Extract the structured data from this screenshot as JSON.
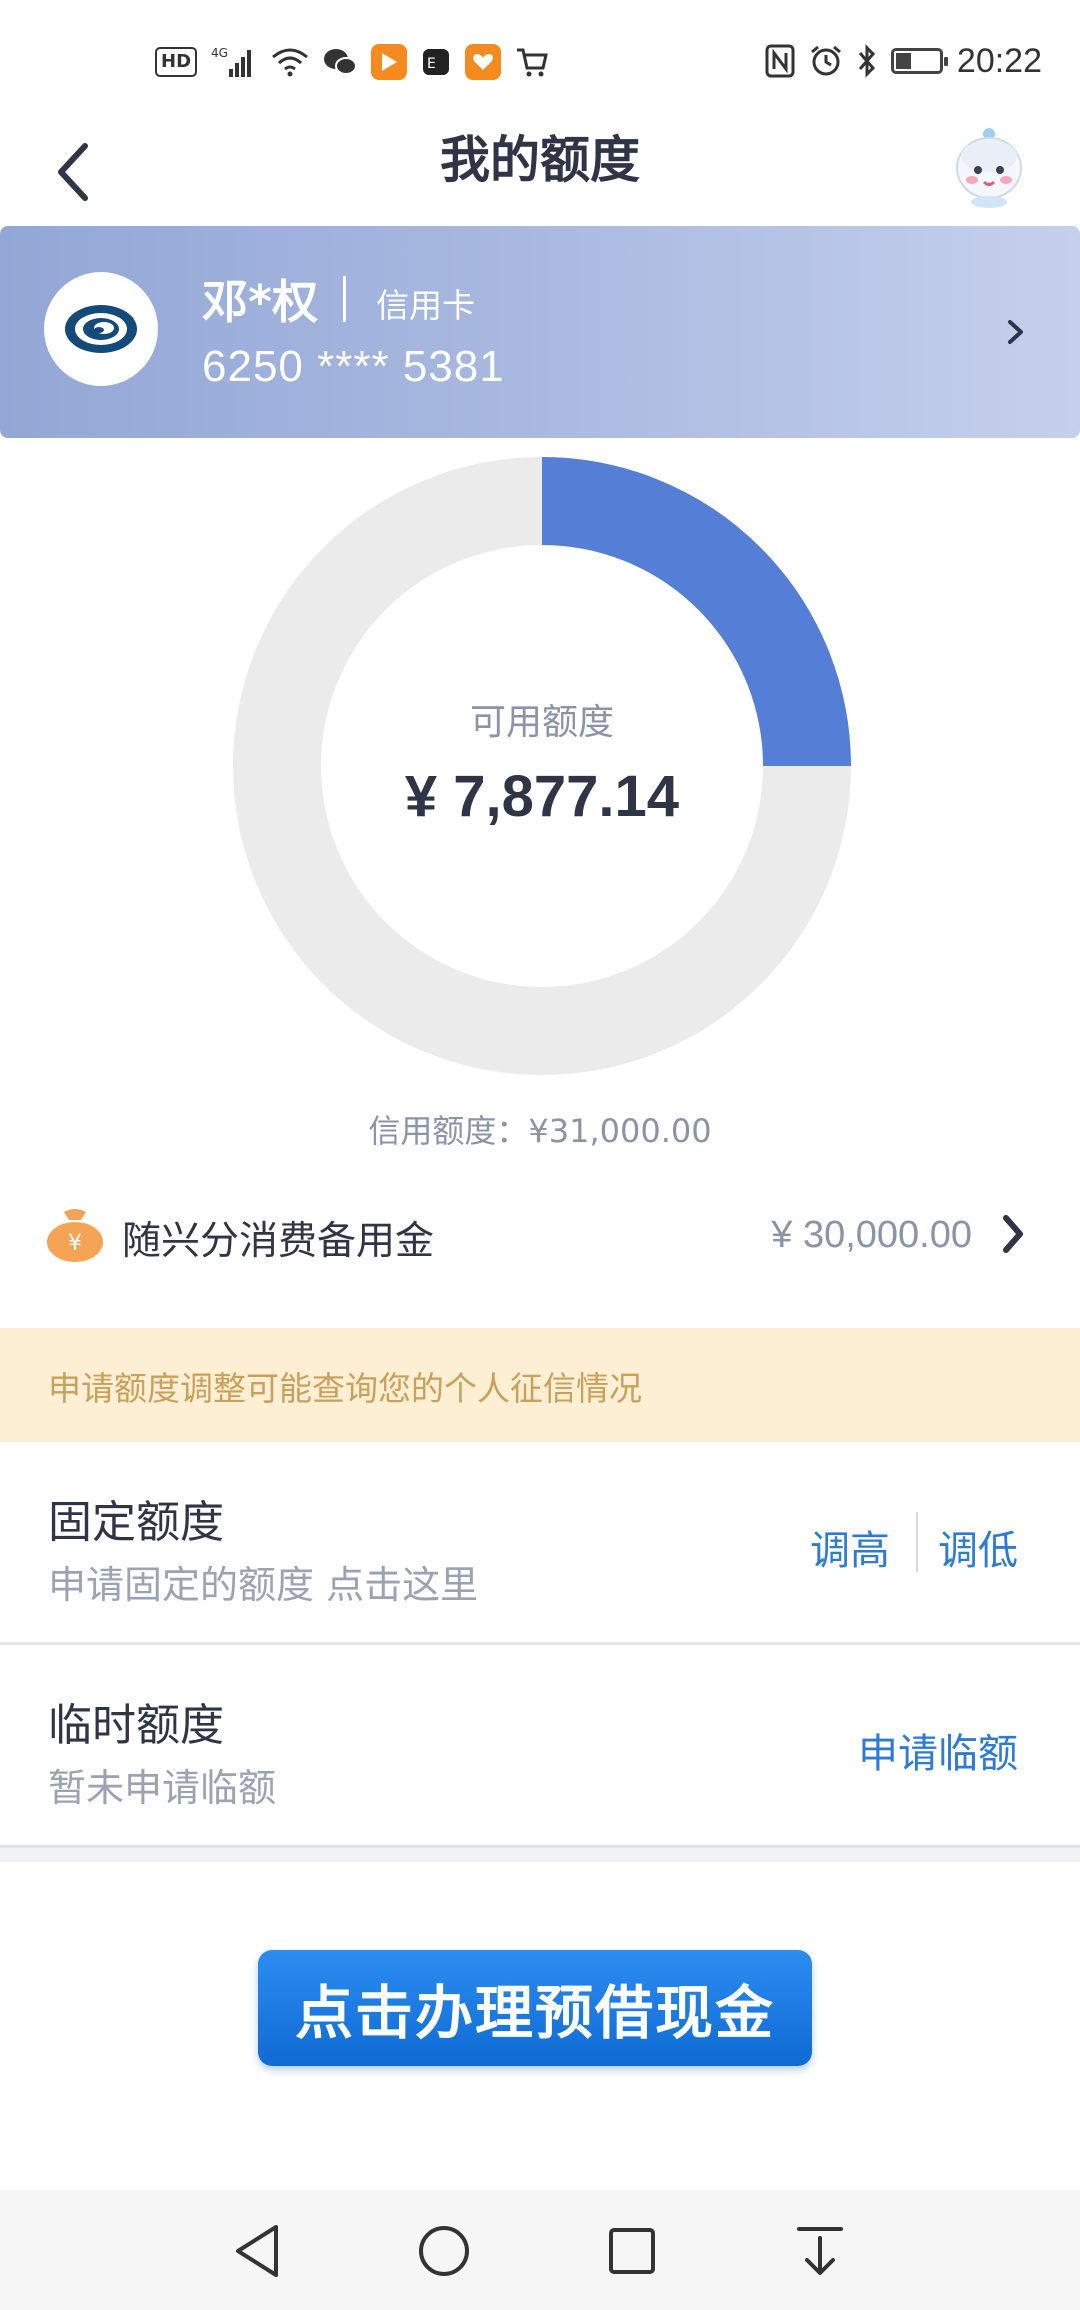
{
  "status_bar": {
    "left_icons": [
      "hd-icon",
      "signal-4g-icon",
      "wifi-icon",
      "wechat-icon",
      "video-app-icon",
      "app-icon",
      "heart-app-icon",
      "cart-icon"
    ],
    "hd_label": "HD",
    "network_label": "4G",
    "right_icons": [
      "nfc-icon",
      "alarm-icon",
      "bluetooth-icon",
      "battery-icon"
    ],
    "battery_level": 0.4,
    "time": "20:22"
  },
  "header": {
    "title": "我的额度",
    "back_icon": "chevron-left-icon",
    "assistant_icon": "mascot-icon"
  },
  "card": {
    "holder": "邓*权",
    "type": "信用卡",
    "number": "6250 **** 5381",
    "logo_icon": "bank-logo-icon",
    "chevron_icon": "chevron-right-icon"
  },
  "donut": {
    "used_fraction": 0.25,
    "used_color": "#557ed6",
    "track_color": "#ebebeb",
    "label": "可用额度",
    "value": "¥ 7,877.14"
  },
  "credit_limit": "信用额度：¥31,000.00",
  "reserve": {
    "icon": "money-bag-icon",
    "label": "随兴分消费备用金",
    "value": "¥ 30,000.00"
  },
  "notice": "申请额度调整可能查询您的个人征信情况",
  "fixed_limit": {
    "title": "固定额度",
    "subtitle": "申请固定的额度 点击这里",
    "increase": "调高",
    "decrease": "调低"
  },
  "temp_limit": {
    "title": "临时额度",
    "subtitle": "暂未申请临额",
    "apply": "申请临额"
  },
  "cta": "点击办理预借现金",
  "nav": [
    "back-nav-icon",
    "home-nav-icon",
    "recents-nav-icon",
    "notification-pull-icon"
  ],
  "colors": {
    "accent_blue": "#2f7bd4",
    "notice_bg": "#fcefd3",
    "notice_text": "#caa05a",
    "banner_start": "#93a7d6",
    "banner_end": "#c5d0ec"
  }
}
